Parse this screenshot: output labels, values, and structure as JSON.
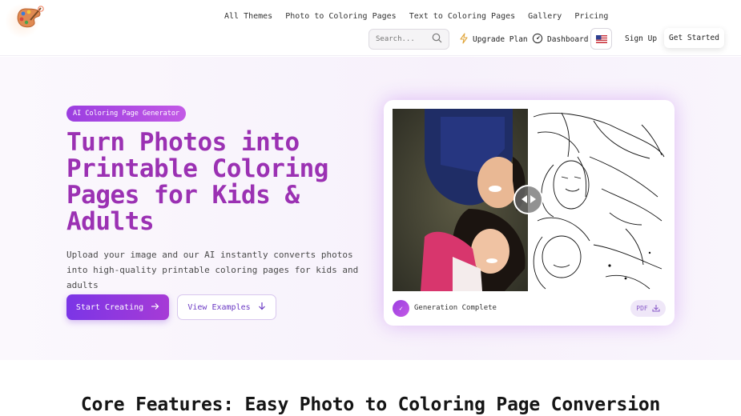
{
  "header": {
    "nav": [
      "All Themes",
      "Photo to Coloring Pages",
      "Text to Coloring Pages",
      "Gallery",
      "Pricing"
    ],
    "search_placeholder": "Search...",
    "upgrade_label": "Upgrade Plan",
    "dashboard_label": "Dashboard",
    "language_flag": "us-flag-icon",
    "signup_label": "Sign Up",
    "getstarted_label": "Get Started"
  },
  "hero": {
    "badge": "AI Coloring Page Generator",
    "headline": "Turn Photos into Printable Coloring Pages for Kids & Adults",
    "subtext": "Upload your image and our AI instantly converts photos into high-quality printable coloring pages for kids and adults",
    "primary_cta": "Start Creating",
    "secondary_cta": "View Examples"
  },
  "preview": {
    "status": "Generation Complete",
    "pdf_label": "PDF"
  },
  "features": {
    "title": "Core Features: Easy Photo to Coloring Page Conversion"
  },
  "colors": {
    "brand_purple": "#9b31b3",
    "accent_gradient_start": "#7b35e6",
    "accent_gradient_end": "#a63bd6"
  }
}
